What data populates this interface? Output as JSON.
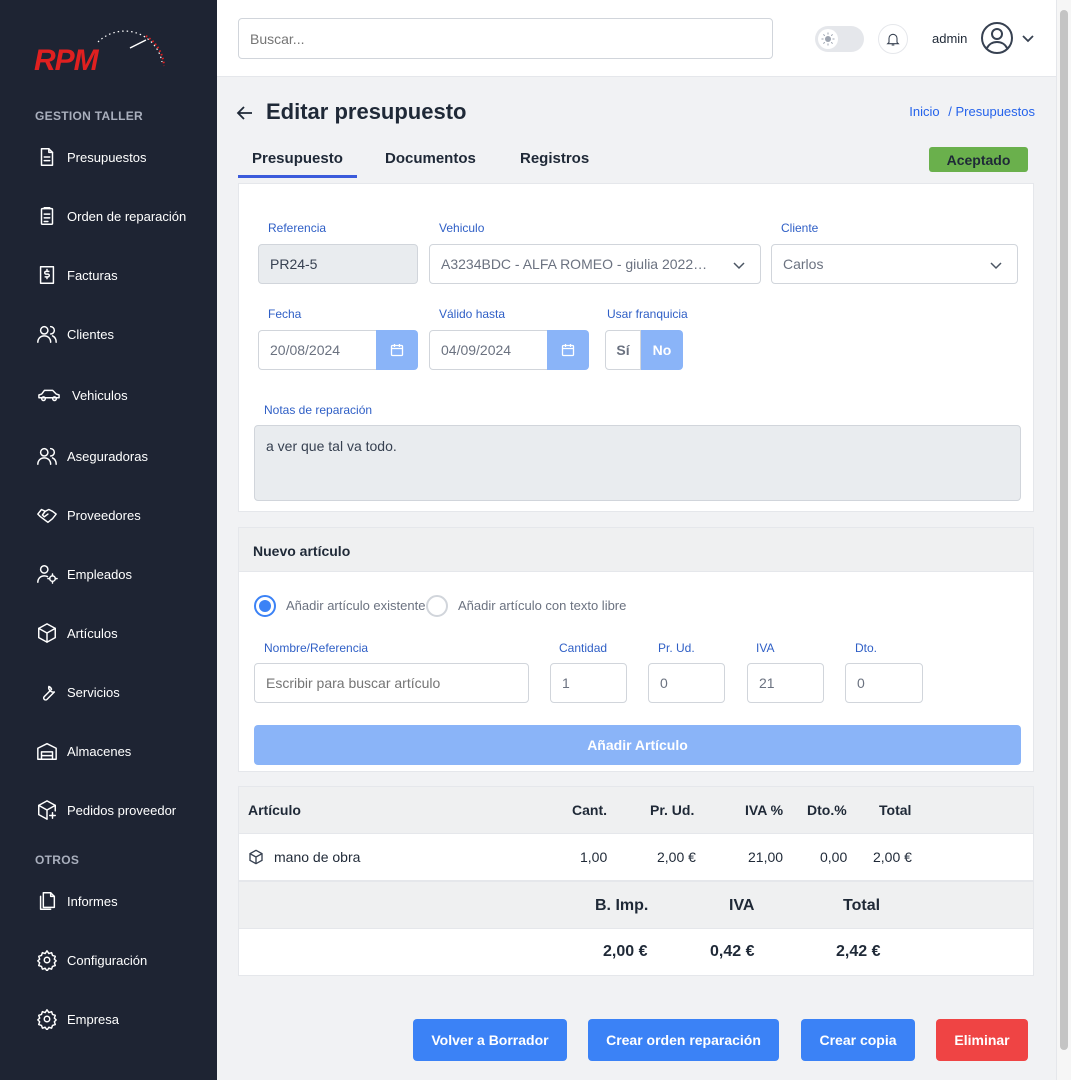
{
  "logo": {
    "text": "RPM"
  },
  "sidebar": {
    "section_taller": "GESTION TALLER",
    "section_otros": "OTROS",
    "items": [
      {
        "label": "Presupuestos",
        "icon": "document-icon"
      },
      {
        "label": "Orden de reparación",
        "icon": "clipboard-icon"
      },
      {
        "label": "Facturas",
        "icon": "invoice-icon"
      },
      {
        "label": "Clientes",
        "icon": "users-icon"
      },
      {
        "label": "Vehiculos",
        "icon": "car-icon"
      },
      {
        "label": "Aseguradoras",
        "icon": "users-icon"
      },
      {
        "label": "Proveedores",
        "icon": "handshake-icon"
      },
      {
        "label": "Empleados",
        "icon": "user-gear-icon"
      },
      {
        "label": "Artículos",
        "icon": "box-icon"
      },
      {
        "label": "Servicios",
        "icon": "wrench-icon"
      },
      {
        "label": "Almacenes",
        "icon": "warehouse-icon"
      },
      {
        "label": "Pedidos proveedor",
        "icon": "box-plus-icon"
      },
      {
        "label": "Informes",
        "icon": "reports-icon"
      },
      {
        "label": "Configuración",
        "icon": "gear-icon"
      },
      {
        "label": "Empresa",
        "icon": "gear-icon"
      }
    ]
  },
  "topbar": {
    "search_placeholder": "Buscar...",
    "user": "admin"
  },
  "page": {
    "title": "Editar presupuesto",
    "breadcrumb_home": "Inicio",
    "breadcrumb_sep": "/",
    "breadcrumb_current": "Presupuestos"
  },
  "tabs": [
    "Presupuesto",
    "Documentos",
    "Registros"
  ],
  "status": "Aceptado",
  "form": {
    "referencia_label": "Referencia",
    "referencia_value": "PR24-5",
    "vehiculo_label": "Vehiculo",
    "vehiculo_value": "A3234BDC - ALFA ROMEO - giulia 2022…",
    "cliente_label": "Cliente",
    "cliente_value": "Carlos",
    "fecha_label": "Fecha",
    "fecha_value": "20/08/2024",
    "valido_label": "Válido hasta",
    "valido_value": "04/09/2024",
    "franquicia_label": "Usar franquicia",
    "franquicia_si": "Sí",
    "franquicia_no": "No",
    "notas_label": "Notas de reparación",
    "notas_value": "a ver que tal va todo."
  },
  "nuevo_articulo": {
    "title": "Nuevo artículo",
    "radio_existente": "Añadir artículo existente",
    "radio_libre": "Añadir artículo con texto libre",
    "nombre_label": "Nombre/Referencia",
    "nombre_placeholder": "Escribir para buscar artículo",
    "cantidad_label": "Cantidad",
    "cantidad_value": "1",
    "prud_label": "Pr. Ud.",
    "prud_value": "0",
    "iva_label": "IVA",
    "iva_value": "21",
    "dto_label": "Dto.",
    "dto_value": "0",
    "add_button": "Añadir Artículo"
  },
  "table": {
    "headers": [
      "Artículo",
      "Cant.",
      "Pr. Ud.",
      "IVA %",
      "Dto.%",
      "Total"
    ],
    "rows": [
      {
        "articulo": "mano de obra",
        "cant": "1,00",
        "prud": "2,00 €",
        "iva": "21,00",
        "dto": "0,00",
        "total": "2,00 €"
      }
    ]
  },
  "totals": {
    "headers": [
      "B. Imp.",
      "IVA",
      "Total"
    ],
    "values": [
      "2,00 €",
      "0,42 €",
      "2,42 €"
    ]
  },
  "actions": {
    "volver": "Volver a Borrador",
    "crear_orden": "Crear orden reparación",
    "crear_copia": "Crear copia",
    "eliminar": "Eliminar"
  },
  "colors": {
    "sidebar_bg": "#1e2433",
    "primary": "#3b82f6",
    "primary_light": "#8ab4f8",
    "success": "#6ab04c",
    "danger": "#ef4444",
    "logo_red": "#e02020"
  }
}
